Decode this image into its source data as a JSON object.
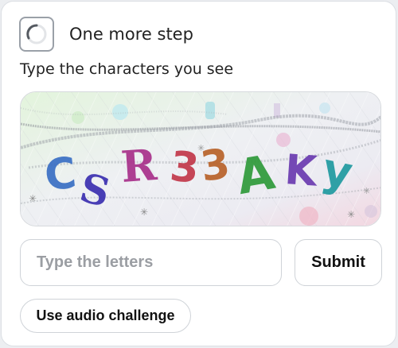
{
  "header": {
    "title": "One more step",
    "status_icon": "loading-spinner-icon"
  },
  "challenge": {
    "instruction": "Type the characters you see",
    "characters": [
      {
        "char": "C",
        "color": "#3a6fc4"
      },
      {
        "char": "S",
        "color": "#3b2fb0"
      },
      {
        "char": "R",
        "color": "#a8308a"
      },
      {
        "char": "3",
        "color": "#c2384a"
      },
      {
        "char": "3",
        "color": "#b8622a"
      },
      {
        "char": "A",
        "color": "#2f9a3a"
      },
      {
        "char": "K",
        "color": "#6a3bb0"
      },
      {
        "char": "y",
        "color": "#1f9aa0"
      }
    ]
  },
  "form": {
    "input_placeholder": "Type the letters",
    "input_value": "",
    "submit_label": "Submit",
    "audio_label": "Use audio challenge"
  },
  "colors": {
    "border": "#cfd3d8",
    "text": "#222222",
    "placeholder": "#9b9ea3"
  }
}
